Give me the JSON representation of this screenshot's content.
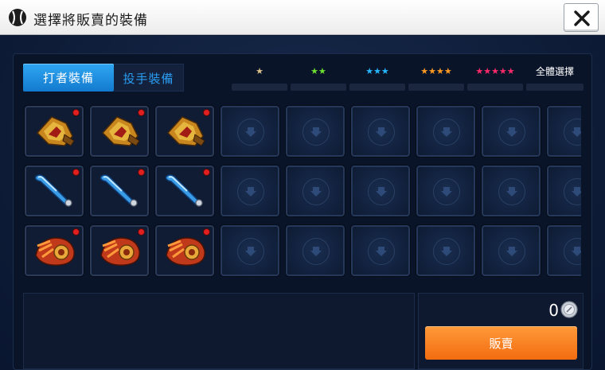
{
  "header": {
    "title": "選擇將販賣的裝備",
    "logo_icon": "baseball-icon",
    "close_icon": "close-icon"
  },
  "tabs": [
    {
      "label": "打者裝備",
      "active": true
    },
    {
      "label": "投手裝備",
      "active": false
    }
  ],
  "filters": [
    {
      "stars": "★",
      "color": "#d9c28c"
    },
    {
      "stars": "★★",
      "color": "#6ee02e"
    },
    {
      "stars": "★★★",
      "color": "#27b7ff"
    },
    {
      "stars": "★★★★",
      "color": "#ff9a22"
    },
    {
      "stars": "★★★★★",
      "color": "#ff2a6a"
    }
  ],
  "select_all_label": "全體選擇",
  "inventory": {
    "rows": [
      {
        "item": "batting-glove-icon",
        "filled_count": 3
      },
      {
        "item": "baseball-bat-icon",
        "filled_count": 3
      },
      {
        "item": "fielding-glove-icon",
        "filled_count": 3
      }
    ],
    "new_badge_color": "#e02020",
    "empty_slot_icon": "arrow-down-icon"
  },
  "sell": {
    "price": "0",
    "currency_icon": "silver-coin-icon",
    "button_label": "販賣",
    "button_color": "#f47a18"
  },
  "colors": {
    "accent": "#1f8fe4",
    "background": "#0c1a33"
  }
}
